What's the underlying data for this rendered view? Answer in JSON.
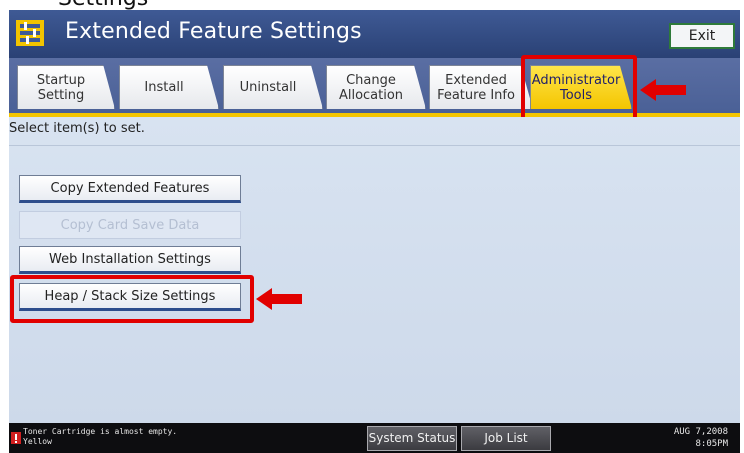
{
  "cropped_header_text": "Settings",
  "window": {
    "title": "Extended Feature Settings",
    "exit_label": "Exit"
  },
  "tabs": [
    {
      "label": "Startup\nSetting",
      "active": false
    },
    {
      "label": "Install",
      "active": false
    },
    {
      "label": "Uninstall",
      "active": false
    },
    {
      "label": "Change\nAllocation",
      "active": false
    },
    {
      "label": "Extended\nFeature Info",
      "active": false
    },
    {
      "label": "Administrator\nTools",
      "active": true
    }
  ],
  "main": {
    "instruction": "Select item(s) to set.",
    "buttons": [
      {
        "label": "Copy Extended Features",
        "enabled": true
      },
      {
        "label": "Copy Card Save Data",
        "enabled": false
      },
      {
        "label": "Web Installation Settings",
        "enabled": true
      },
      {
        "label": "Heap / Stack Size Settings",
        "enabled": true
      }
    ]
  },
  "status": {
    "message": "Toner Cartridge is almost empty.\nYellow",
    "system_status_label": "System Status",
    "job_list_label": "Job List",
    "date": "AUG    7,2008",
    "time": "8:05PM"
  },
  "colors": {
    "title_bar": "#2f4a86",
    "active_tab": "#f4c500",
    "highlight": "#e10000",
    "content_bg": "#d8e3f1"
  },
  "icons": {
    "title": "feature-settings-icon",
    "annotation": "red-arrow-icon",
    "status": "toner-warning-icon"
  }
}
